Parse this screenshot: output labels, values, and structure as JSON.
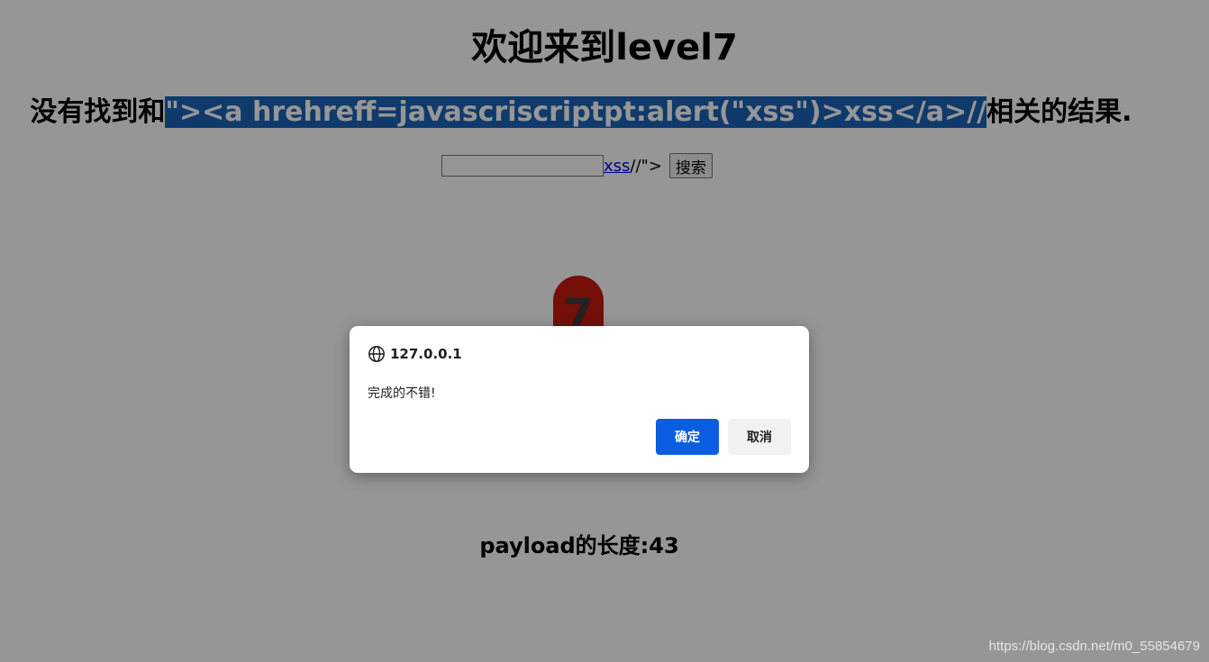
{
  "page": {
    "title": "欢迎来到level7",
    "result_prefix": "没有找到和",
    "result_query": "\"><a hrehreff=javascriscriptpt:alert(\"xss\")>xss</a>//",
    "result_suffix": "相关的结果.",
    "search": {
      "input_value": "",
      "link_text": "xss",
      "trailing_text": "//\">",
      "button_label": "搜索"
    },
    "badge_number": "7",
    "payload_length": "payload的长度:43"
  },
  "dialog": {
    "origin": "127.0.0.1",
    "message": "完成的不错!",
    "ok_label": "确定",
    "cancel_label": "取消"
  },
  "watermark": "https://blog.csdn.net/m0_55854679",
  "colors": {
    "highlight": "#1a64b6",
    "ok_button": "#0b5ee0",
    "badge": "#c51a12"
  }
}
